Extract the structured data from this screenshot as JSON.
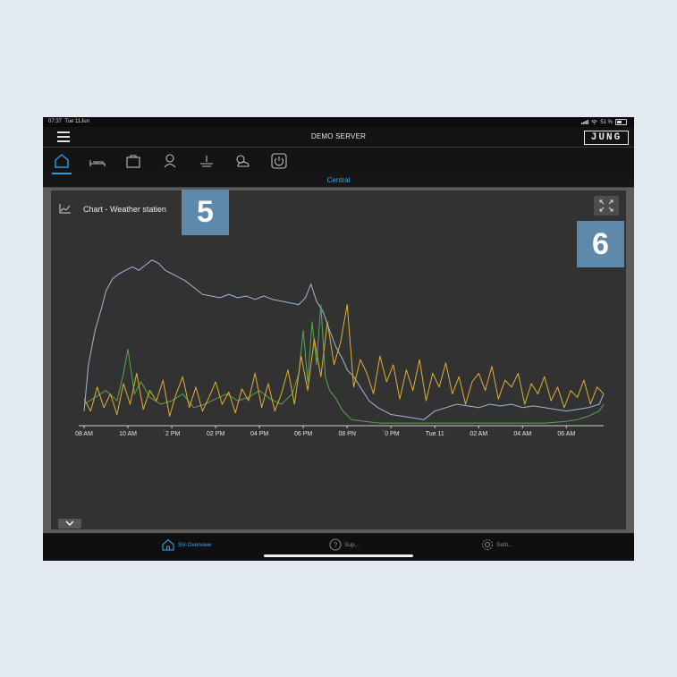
{
  "status_bar": {
    "time": "07:37",
    "date": "Tue 11Jun",
    "battery": "51 %"
  },
  "app_bar": {
    "title": "DEMO SERVER",
    "logo": "JUNG"
  },
  "nav": {
    "items": [
      {
        "name": "home-icon",
        "active": true
      },
      {
        "name": "bed-icon",
        "active": false
      },
      {
        "name": "briefcase-icon",
        "active": false
      },
      {
        "name": "person-icon",
        "active": false
      },
      {
        "name": "heating-icon",
        "active": false
      },
      {
        "name": "weather-icon",
        "active": false
      },
      {
        "name": "power-icon",
        "active": false
      }
    ],
    "accent_color": "#2b9be0"
  },
  "section": {
    "label": "Central"
  },
  "card": {
    "title": "Chart - Weather statien"
  },
  "callouts": {
    "first": "5",
    "second": "6"
  },
  "chart_data": {
    "type": "line",
    "title": "Chart - Weather statien",
    "x_ticks": [
      "08 AM",
      "10 AM",
      "´2 PM",
      "02 PM",
      "04 PM",
      "06 PM",
      "08 PN",
      "´0 PM",
      "Tue 11",
      "02 AM",
      "04 AM",
      "06 AM"
    ],
    "x_hours": [
      0,
      2,
      4,
      6,
      8,
      10,
      12,
      14,
      16,
      18,
      20,
      22
    ],
    "x_range": [
      0,
      23.7
    ],
    "y_range": [
      0,
      100
    ],
    "grid": false,
    "series": [
      {
        "color": "#9db8d6",
        "hours": [
          0,
          0.2,
          0.5,
          0.8,
          1.0,
          1.3,
          1.6,
          1.9,
          2.2,
          2.5,
          2.8,
          3.1,
          3.4,
          3.7,
          4.0,
          4.3,
          4.6,
          5.0,
          5.4,
          5.8,
          6.2,
          6.6,
          7.0,
          7.4,
          7.8,
          8.2,
          8.6,
          9.0,
          9.4,
          9.8,
          10.1,
          10.35,
          10.6,
          10.9,
          11.2,
          11.5,
          11.8,
          12.0,
          12.3,
          12.6,
          13.0,
          13.4,
          14.0,
          14.5,
          15.0,
          15.5,
          16.0,
          16.5,
          17.0,
          17.5,
          18.0,
          18.5,
          19.0,
          19.5,
          20.0,
          20.5,
          21.0,
          21.5,
          22.0,
          22.5,
          23.0,
          23.5,
          23.7
        ],
        "values": [
          8,
          35,
          55,
          68,
          78,
          85,
          88,
          90,
          92,
          90,
          93,
          96,
          94,
          90,
          88,
          86,
          84,
          80,
          76,
          75,
          74,
          76,
          74,
          75,
          73,
          75,
          73,
          72,
          71,
          70,
          74,
          82,
          72,
          66,
          55,
          45,
          38,
          32,
          28,
          22,
          14,
          10,
          6,
          5,
          4,
          3,
          8,
          10,
          12,
          11,
          10,
          12,
          11,
          12,
          10,
          11,
          10,
          9,
          8,
          9,
          10,
          12,
          18
        ]
      },
      {
        "color": "#5aa455",
        "hours": [
          0,
          0.5,
          1.0,
          1.5,
          1.8,
          2.0,
          2.3,
          2.6,
          3.0,
          3.5,
          4.0,
          4.5,
          5.0,
          5.5,
          6.0,
          6.5,
          7.0,
          7.5,
          8.0,
          8.5,
          9.0,
          9.5,
          9.8,
          10.0,
          10.2,
          10.4,
          10.6,
          10.8,
          11.0,
          11.2,
          11.5,
          11.8,
          12.2,
          12.8,
          13.5,
          14.5,
          16.0,
          18.0,
          20.0,
          21.0,
          22.0,
          22.5,
          23.0,
          23.5,
          23.7
        ],
        "values": [
          12,
          16,
          20,
          14,
          30,
          44,
          18,
          25,
          16,
          12,
          14,
          18,
          10,
          12,
          15,
          18,
          14,
          16,
          20,
          15,
          12,
          18,
          30,
          55,
          25,
          60,
          35,
          70,
          28,
          20,
          15,
          8,
          3,
          2,
          1,
          1,
          1,
          1,
          1,
          1,
          2,
          3,
          5,
          8,
          12
        ]
      },
      {
        "color": "#e0b030",
        "hours": [
          0,
          0.3,
          0.6,
          0.9,
          1.2,
          1.5,
          1.8,
          2.1,
          2.4,
          2.7,
          3.0,
          3.3,
          3.6,
          3.9,
          4.2,
          4.5,
          4.8,
          5.1,
          5.4,
          5.7,
          6.0,
          6.3,
          6.6,
          6.9,
          7.2,
          7.5,
          7.8,
          8.1,
          8.4,
          8.7,
          9.0,
          9.3,
          9.6,
          9.9,
          10.2,
          10.5,
          10.8,
          11.1,
          11.4,
          11.7,
          12.0,
          12.3,
          12.6,
          12.9,
          13.2,
          13.5,
          13.8,
          14.1,
          14.4,
          14.7,
          15.0,
          15.3,
          15.6,
          15.9,
          16.2,
          16.5,
          16.8,
          17.1,
          17.4,
          17.7,
          18.0,
          18.3,
          18.6,
          18.9,
          19.2,
          19.5,
          19.8,
          20.1,
          20.4,
          20.7,
          21.0,
          21.3,
          21.6,
          21.9,
          22.2,
          22.5,
          22.8,
          23.1,
          23.4,
          23.7
        ],
        "values": [
          15,
          8,
          22,
          10,
          18,
          6,
          24,
          12,
          30,
          9,
          20,
          14,
          26,
          5,
          18,
          28,
          10,
          22,
          8,
          16,
          25,
          12,
          19,
          7,
          21,
          14,
          30,
          10,
          24,
          8,
          18,
          32,
          12,
          40,
          20,
          50,
          28,
          60,
          35,
          48,
          70,
          22,
          38,
          30,
          18,
          40,
          25,
          35,
          15,
          32,
          20,
          38,
          14,
          30,
          22,
          36,
          18,
          28,
          12,
          25,
          30,
          20,
          34,
          15,
          26,
          22,
          30,
          12,
          24,
          18,
          28,
          14,
          22,
          10,
          20,
          16,
          26,
          12,
          22,
          18
        ]
      }
    ]
  },
  "bottom_tabs": {
    "overview": "SV-Overview",
    "support": "Sup...",
    "settings": "Setti..."
  }
}
